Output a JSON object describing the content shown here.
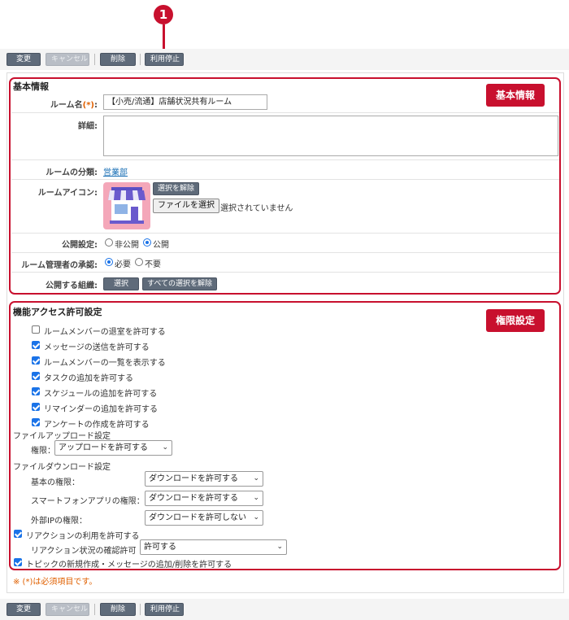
{
  "marker": {
    "number": "1"
  },
  "toolbar": {
    "change": "変更",
    "cancel": "キャンセル",
    "delete": "削除",
    "suspend": "利用停止"
  },
  "basic": {
    "title": "基本情報",
    "badge": "基本情報",
    "room_name_label": "ルーム名",
    "required_mark": "(*)",
    "colon": ":",
    "room_name_value": "【小売/流通】店舗状況共有ルーム",
    "detail_label": "詳細",
    "category_label": "ルームの分類",
    "category_value": "営業部",
    "icon_label": "ルームアイコン",
    "clear_selection": "選択を解除",
    "file_button": "ファイルを選択",
    "no_file": "選択されていません",
    "publish_label": "公開設定",
    "publish_private": "非公開",
    "publish_public": "公開",
    "approval_label": "ルーム管理者の承認",
    "approval_required": "必要",
    "approval_not_required": "不要",
    "org_label": "公開する組織",
    "org_select": "選択",
    "org_clear_all": "すべての選択を解除"
  },
  "permissions": {
    "title": "機能アクセス許可設定",
    "badge": "権限設定",
    "checkboxes": [
      {
        "label": "ルームメンバーの退室を許可する",
        "checked": false
      },
      {
        "label": "メッセージの送信を許可する",
        "checked": true
      },
      {
        "label": "ルームメンバーの一覧を表示する",
        "checked": true
      },
      {
        "label": "タスクの追加を許可する",
        "checked": true
      },
      {
        "label": "スケジュールの追加を許可する",
        "checked": true
      },
      {
        "label": "リマインダーの追加を許可する",
        "checked": true
      },
      {
        "label": "アンケートの作成を許可する",
        "checked": true
      }
    ],
    "upload_heading": "ファイルアップロード設定",
    "upload_perm_label": "権限：",
    "upload_perm_value": "アップロードを許可する",
    "download_heading": "ファイルダウンロード設定",
    "dl_basic_label": "基本の権限：",
    "dl_basic_value": "ダウンロードを許可する",
    "dl_phone_label": "スマートフォンアプリの権限：",
    "dl_phone_value": "ダウンロードを許可する",
    "dl_ip_label": "外部IPの権限：",
    "dl_ip_value": "ダウンロードを許可しない",
    "reaction_label": "リアクションの利用を許可する",
    "reaction_confirm_label": "リアクション状況の確認許可",
    "reaction_confirm_value": "許可する",
    "topic_label": "トピックの新規作成・メッセージの追加/削除を許可する"
  },
  "footer_note": "※ (*)は必須項目です。",
  "colors": {
    "accent_red": "#c8102e",
    "button_gray": "#5f6b7a",
    "check_blue": "#1a73e8"
  }
}
